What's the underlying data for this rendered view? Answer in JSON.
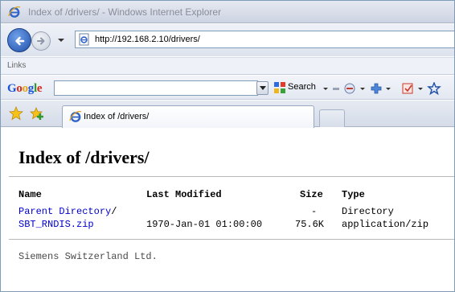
{
  "window": {
    "title": "Index of /drivers/ - Windows Internet Explorer"
  },
  "address_bar": {
    "url": "http://192.168.2.10/drivers/"
  },
  "links_bar": {
    "label": "Links"
  },
  "google_toolbar": {
    "logo": "Google",
    "search_value": "",
    "search_label": "Search"
  },
  "tabs": [
    {
      "label": "Index of /drivers/"
    }
  ],
  "page": {
    "heading": "Index of /drivers/",
    "columns": {
      "name": "Name",
      "last_modified": "Last Modified",
      "size": "Size",
      "type": "Type"
    },
    "rows": [
      {
        "name": "Parent Directory",
        "suffix": "/",
        "last_modified": "",
        "size": "-",
        "type": "Directory"
      },
      {
        "name": "SBT_RNDIS.zip",
        "suffix": "",
        "last_modified": "1970-Jan-01 01:00:00",
        "size": "75.6K",
        "type": "application/zip"
      }
    ],
    "footer": "Siemens Switzerland Ltd."
  }
}
